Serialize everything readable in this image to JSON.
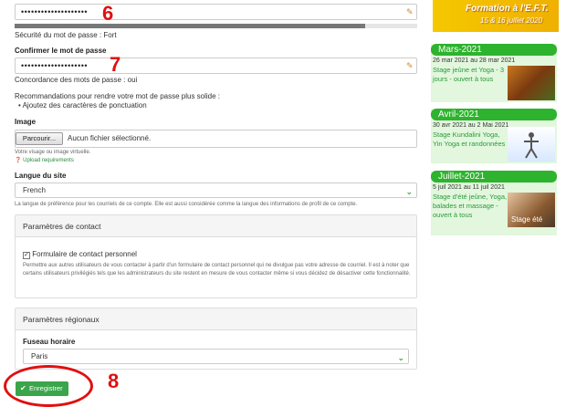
{
  "form": {
    "password_value": "••••••••••••••••••••",
    "password_strength": "Sécurité du mot de passe : Fort",
    "password_strength_level": 0.87,
    "confirm_label": "Confirmer le mot de passe",
    "confirm_value": "••••••••••••••••••••",
    "match_text": "Concordance des mots de passe : oui",
    "recommend_title": "Recommandations pour rendre votre mot de passe plus solide :",
    "recommend_item": "Ajoutez des caractères de ponctuation",
    "image_label": "Image",
    "file_button": "Parcourir...",
    "file_status": "Aucun fichier sélectionné.",
    "image_help": "Votre visage ou image virtuelle.",
    "upload_link": "Upload requirements",
    "lang_label": "Langue du site",
    "lang_value": "French",
    "lang_help": "La langue de préférence pour les courriels de ce compte. Elle est aussi considérée comme la langue des informations de profil de ce compte.",
    "contact_title": "Paramètres de contact",
    "contact_checkbox": "Formulaire de contact personnel",
    "contact_help": "Permettre aux autres utilisateurs de vous contacter à partir d'un formulaire de contact personnel qui ne divulgue pas votre adresse de courriel. Il est à noter que certains utilisateurs privilégiés tels que les administrateurs du site restent en mesure de vous contacter même si vous décidez de désactiver cette fonctionnalité.",
    "regional_title": "Paramètres régionaux",
    "timezone_label": "Fuseau horaire",
    "timezone_value": "Paris",
    "save_label": "Enregistrer"
  },
  "annotations": {
    "a6": "6",
    "a7": "7",
    "a8": "8"
  },
  "sidebar": {
    "banner_title": "Formation à l'E.F.T.",
    "banner_dates": "15 & 16 juillet 2020",
    "events": [
      {
        "month": "Mars-2021",
        "dates": "26 mar 2021 au 28 mar 2021",
        "desc": "Stage jeûne et Yoga - 3 jours - ouvert à tous"
      },
      {
        "month": "Avril-2021",
        "dates": "30 avr 2021 au 2 Mai 2021",
        "desc": "Stage Kundalini Yoga, Yin Yoga et randonnées"
      },
      {
        "month": "Juillet-2021",
        "dates": "5 juil 2021 au 11 juil 2021",
        "desc": "Stage d'été jeûne, Yoga, balades et massage - ouvert à tous",
        "img_caption": "Stage été"
      }
    ]
  },
  "colors": {
    "accent_green": "#3aa54a",
    "annotation_red": "#e01010",
    "event_bg": "#e2f7dd"
  }
}
